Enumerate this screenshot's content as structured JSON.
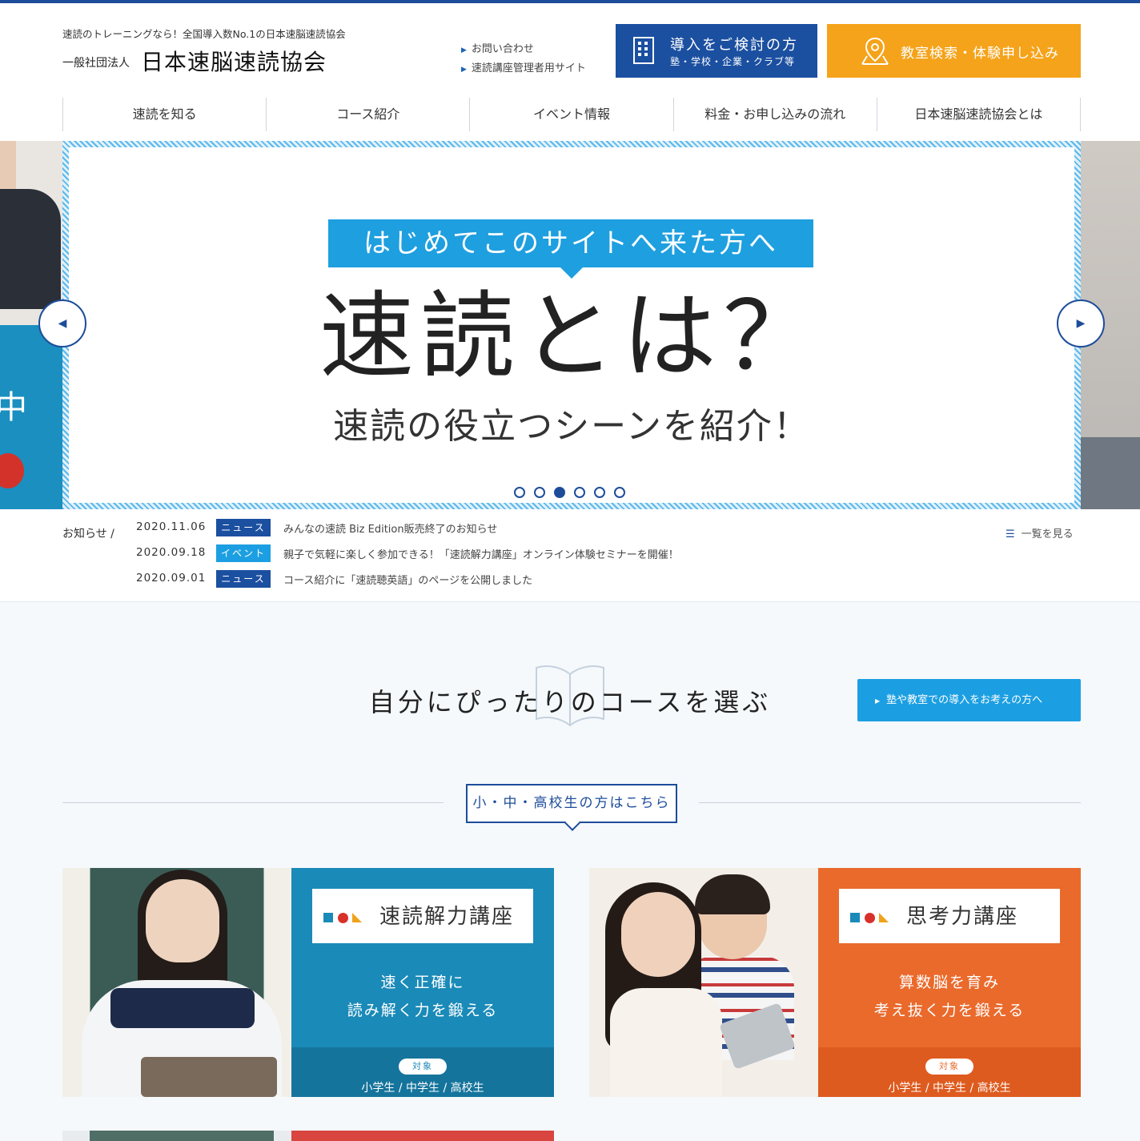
{
  "header": {
    "tagline": "速読のトレーニングなら！全国導入数No.1の日本速脳速読協会",
    "org_type": "一般社団法人",
    "org_name": "日本速脳速読協会",
    "sublinks": [
      "お問い合わせ",
      "速読講座管理者用サイト"
    ],
    "intro_button": {
      "title": "導入をご検討の方",
      "subtitle": "塾・学校・企業・クラブ等"
    },
    "trial_button": "教室検索・体験申し込み"
  },
  "nav": [
    "速読を知る",
    "コース紹介",
    "イベント情報",
    "料金・お申し込みの流れ",
    "日本速脳速読協会とは"
  ],
  "hero": {
    "badge": "はじめてこのサイトへ来た方へ",
    "title": "速読とは？",
    "subtitle": "速読の役立つシーンを紹介！",
    "slide_count": 6,
    "active_slide": 3,
    "left_kanji": "中"
  },
  "news": {
    "label": "お知らせ /",
    "view_all": "一覧を見る",
    "items": [
      {
        "date": "2020.11.06",
        "category": "ニュース",
        "title": "みんなの速読 Biz Edition販売終了のお知らせ"
      },
      {
        "date": "2020.09.18",
        "category": "イベント",
        "title": "親子で気軽に楽しく参加できる！「速読解力講座」オンライン体験セミナーを開催！"
      },
      {
        "date": "2020.09.01",
        "category": "ニュース",
        "title": "コース紹介に「速読聴英語」のページを公開しました"
      }
    ]
  },
  "courses": {
    "title": "自分にぴったりのコースを選ぶ",
    "school_button": "塾や教室での導入をお考えの方へ",
    "target_box": "小・中・高校生の方はこちら",
    "cards": [
      {
        "name": "速読解力講座",
        "desc_lines": [
          "速く正確に",
          "読み解く力を鍛える"
        ],
        "target_label": "対象",
        "target": "小学生 / 中学生 / 高校生"
      },
      {
        "name": "思考力講座",
        "desc_lines": [
          "算数脳を育み",
          "考え抜く力を鍛える"
        ],
        "target_label": "対象",
        "target": "小学生 / 中学生 / 高校生"
      }
    ]
  },
  "colors": {
    "brand_navy": "#1b4fa0",
    "accent_orange": "#f5a31a",
    "accent_blue": "#1c9fe2",
    "news_cat_news": "#1b4fa0",
    "news_cat_event": "#1c9fe2",
    "card1": "#1a8ab8",
    "card1_dark": "#15749c",
    "card2": "#ea6a2c",
    "card2_dark": "#de5b1f"
  },
  "icons": {
    "intro_button": "building-icon",
    "trial_button": "map-pin-icon",
    "sublink": "triangle-right-icon",
    "view_all": "list-icon",
    "prev": "arrow-left-icon",
    "next": "arrow-right-icon"
  }
}
